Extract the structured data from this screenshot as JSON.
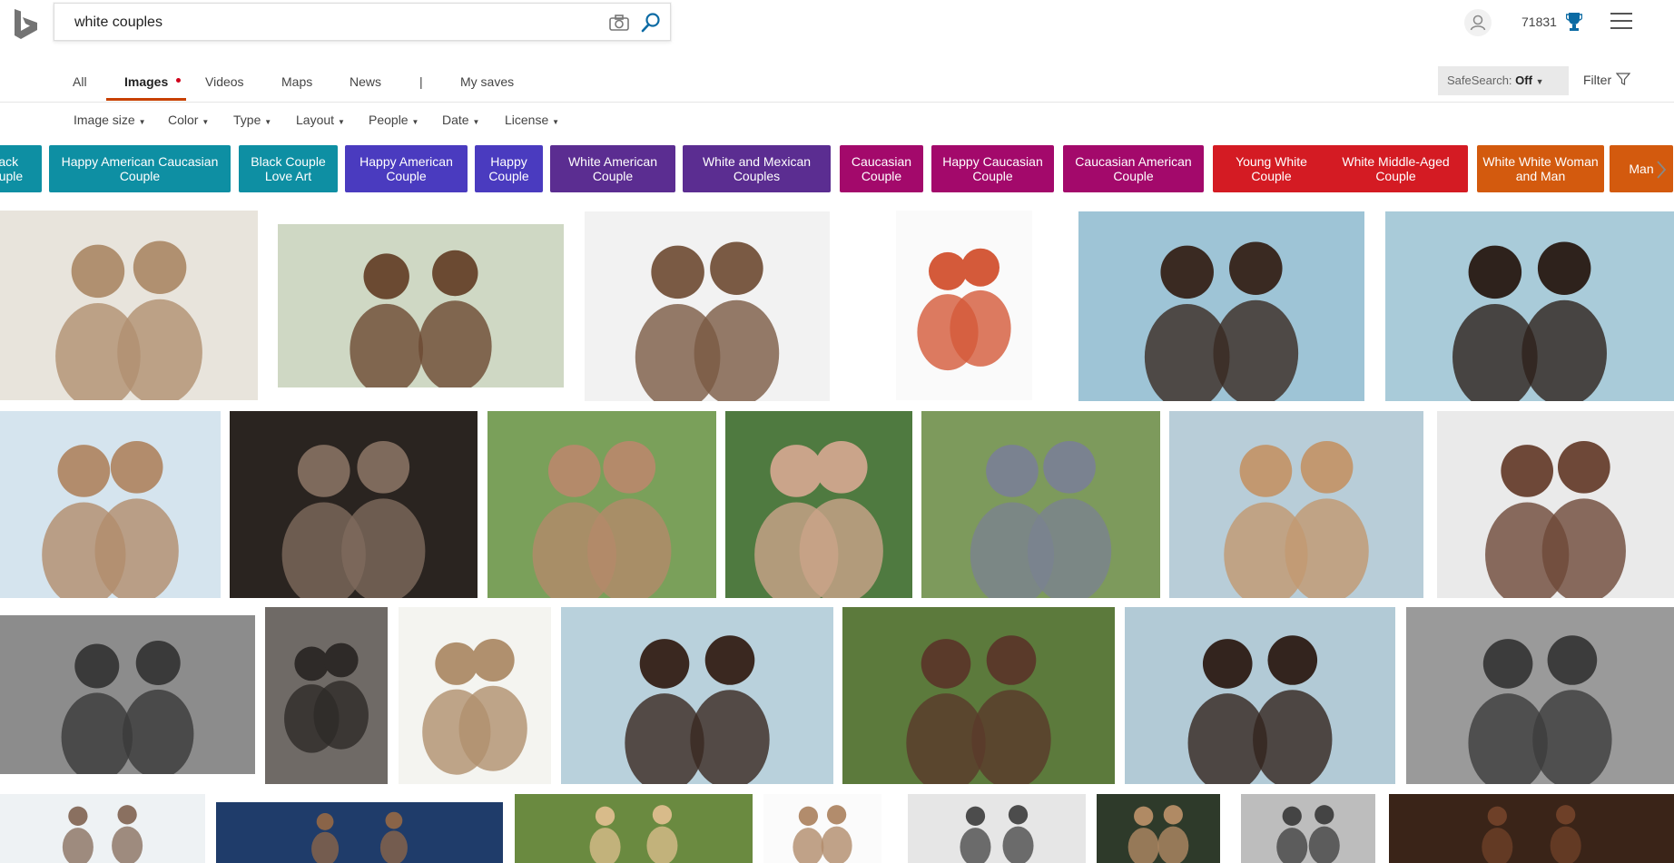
{
  "search": {
    "query": "white couples"
  },
  "header": {
    "points": "71831"
  },
  "nav": {
    "items": [
      "All",
      "Images",
      "Videos",
      "Maps",
      "News",
      "|",
      "My saves"
    ],
    "safesearch_label": "SafeSearch:",
    "safesearch_value": "Off",
    "filter_label": "Filter"
  },
  "filters": [
    "Image size",
    "Color",
    "Type",
    "Layout",
    "People",
    "Date",
    "License"
  ],
  "pills": [
    {
      "label": "Black Couple",
      "color": "#0e8fa3"
    },
    {
      "label": "Happy American Caucasian Couple",
      "color": "#0e8fa3"
    },
    {
      "label": "Black Couple Love Art",
      "color": "#0e8fa3"
    },
    {
      "label": "Happy American Couple",
      "color": "#4a3bbf"
    },
    {
      "label": "Happy Couple",
      "color": "#4a3bbf"
    },
    {
      "label": "White American Couple",
      "color": "#5b2d91"
    },
    {
      "label": "White and Mexican Couples",
      "color": "#5b2d91"
    },
    {
      "label": "Caucasian Couple",
      "color": "#a3096b"
    },
    {
      "label": "Happy Caucasian Couple",
      "color": "#a3096b"
    },
    {
      "label": "Caucasian American Couple",
      "color": "#a3096b"
    },
    {
      "label": "Young White Couple",
      "color": "#d41b23"
    },
    {
      "label": "White Middle-Aged Couple",
      "color": "#d41b23"
    },
    {
      "label": "White White Woman and Man",
      "color": "#d35a0e"
    },
    {
      "label": "Man",
      "color": "#d35a0e"
    }
  ],
  "images": [
    {
      "name": "couple dancing",
      "bg": "#e8e4dc",
      "fg": "#b09070"
    },
    {
      "name": "interracial couple scarf",
      "bg": "#cfd8c4",
      "fg": "#6b4a32"
    },
    {
      "name": "smiling couple",
      "bg": "#f2f2f2",
      "fg": "#7a5a44"
    },
    {
      "name": "couple holding money",
      "bg": "#fafafa",
      "fg": "#d45a3a"
    },
    {
      "name": "couple gettyimages",
      "bg": "#9ec4d6",
      "fg": "#3a2a22"
    },
    {
      "name": "couple kiss cheek",
      "bg": "#a9cbd9",
      "fg": "#2e221c"
    },
    {
      "name": "couple beach",
      "bg": "#d5e4ee",
      "fg": "#b28c6c"
    },
    {
      "name": "couple dark background",
      "bg": "#2a2420",
      "fg": "#7e6a5c"
    },
    {
      "name": "asian couple park",
      "bg": "#7aa05a",
      "fg": "#b48a6a"
    },
    {
      "name": "family with baby",
      "bg": "#4f7a40",
      "fg": "#caa48a"
    },
    {
      "name": "couple walking",
      "bg": "#7d9a5c",
      "fg": "#7a8290"
    },
    {
      "name": "couple beach hug",
      "bg": "#b8cdd8",
      "fg": "#c29870"
    },
    {
      "name": "couple smiling",
      "bg": "#eaeaea",
      "fg": "#6e4838"
    },
    {
      "name": "couple beach bw",
      "bg": "#8c8c8c",
      "fg": "#3a3a3a"
    },
    {
      "name": "couple close bw",
      "bg": "#6f6a66",
      "fg": "#2e2a28"
    },
    {
      "name": "couple hugging",
      "bg": "#f4f4f0",
      "fg": "#b0906e"
    },
    {
      "name": "couple kissing gettyimages",
      "bg": "#b9d1dc",
      "fg": "#3a2820"
    },
    {
      "name": "couple laughing outdoors",
      "bg": "#5c7a3c",
      "fg": "#5a3a2a"
    },
    {
      "name": "couple kissing",
      "bg": "#b2cad6",
      "fg": "#33241e"
    },
    {
      "name": "couple embrace bw",
      "bg": "#9a9a9a",
      "fg": "#3c3c3c"
    },
    {
      "name": "couple portrait",
      "bg": "#eef2f4",
      "fg": "#8a7060"
    },
    {
      "name": "couple in car",
      "bg": "#1f3c6a",
      "fg": "#8a6448"
    },
    {
      "name": "couple blond",
      "bg": "#6a8a40",
      "fg": "#d8bb8a"
    },
    {
      "name": "couple white background",
      "bg": "#fbfbfb",
      "fg": "#b28c6c"
    },
    {
      "name": "couple collage",
      "bg": "#e6e6e6",
      "fg": "#4c4c4c"
    },
    {
      "name": "couple green",
      "bg": "#2e3a2a",
      "fg": "#b08a64"
    },
    {
      "name": "couple bw portrait",
      "bg": "#bdbdbd",
      "fg": "#444"
    },
    {
      "name": "couple dark skin",
      "bg": "#3a2418",
      "fg": "#6e4028"
    }
  ]
}
